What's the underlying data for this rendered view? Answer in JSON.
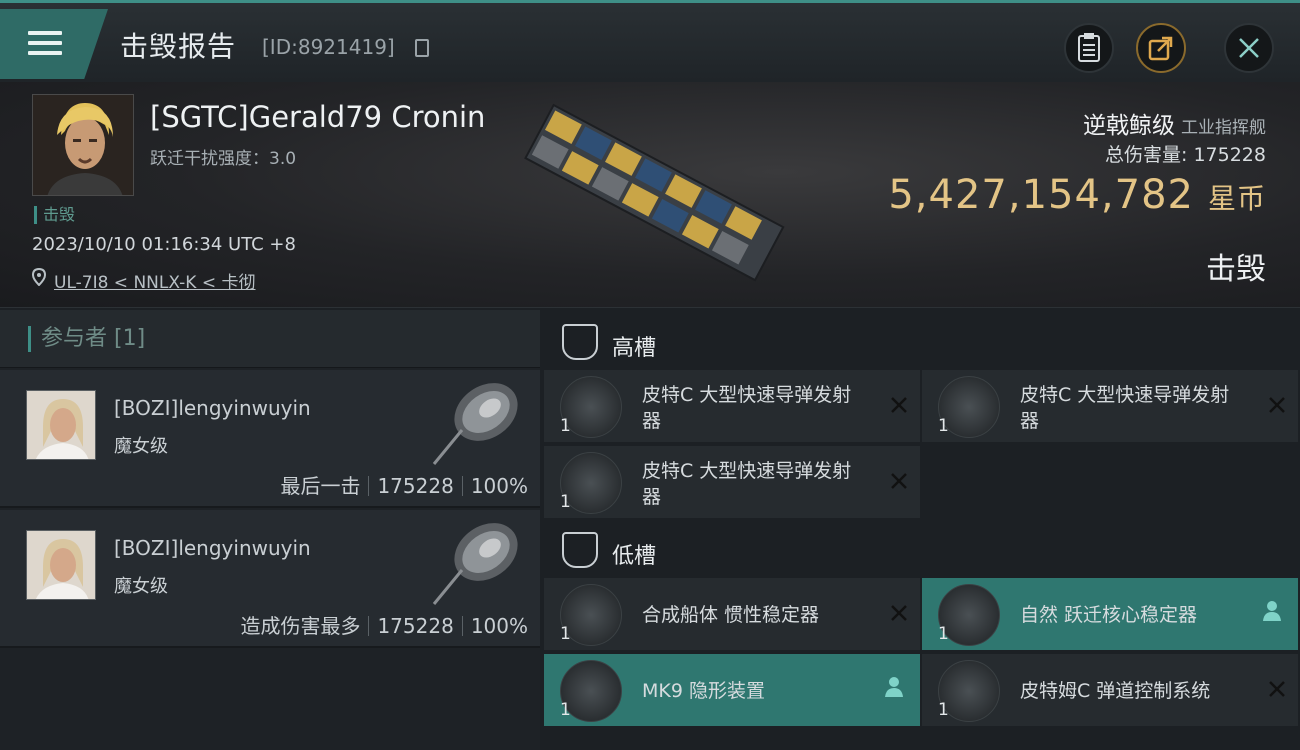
{
  "header": {
    "title": "击毁报告",
    "kill_id": "[ID:8921419]"
  },
  "victim": {
    "name": "[SGTC]Gerald79 Cronin",
    "warp_disruption": "跃迁干扰强度：3.0",
    "tag": "击毁",
    "datetime": "2023/10/10 01:16:34 UTC +8",
    "location": "UL-7I8 < NNLX-K < 卡彻",
    "ship_class": "逆戟鲸级",
    "ship_subtype": "工业指挥舰",
    "total_damage": "总伤害量: 175228",
    "isk_value": "5,427,154,782",
    "isk_unit": "星币",
    "status": "击毁"
  },
  "participants": {
    "header": "参与者 [1]",
    "rows": [
      {
        "name": "[BOZI]lengyinwuyin",
        "ship": "魔女级",
        "role": "最后一击",
        "damage": "175228",
        "percent": "100%"
      },
      {
        "name": "[BOZI]lengyinwuyin",
        "ship": "魔女级",
        "role": "造成伤害最多",
        "damage": "175228",
        "percent": "100%"
      }
    ]
  },
  "fittings": {
    "high_label": "高槽",
    "low_label": "低槽",
    "high": [
      {
        "qty": "1",
        "name": "皮特C 大型快速导弹发射器",
        "destroyed": true
      },
      {
        "qty": "1",
        "name": "皮特C 大型快速导弹发射器",
        "destroyed": true
      },
      {
        "qty": "1",
        "name": "皮特C 大型快速导弹发射器",
        "destroyed": true
      }
    ],
    "low": [
      {
        "qty": "1",
        "name": "合成船体 惯性稳定器",
        "destroyed": true
      },
      {
        "qty": "1",
        "name": "自然 跃迁核心稳定器",
        "destroyed": false
      },
      {
        "qty": "1",
        "name": "MK9 隐形装置",
        "destroyed": false
      },
      {
        "qty": "1",
        "name": "皮特姆C 弹道控制系统",
        "destroyed": true
      }
    ]
  },
  "colors": {
    "accent": "#3e8f87",
    "isk": "#e3c486",
    "dropped_highlight": "#2f7770"
  }
}
